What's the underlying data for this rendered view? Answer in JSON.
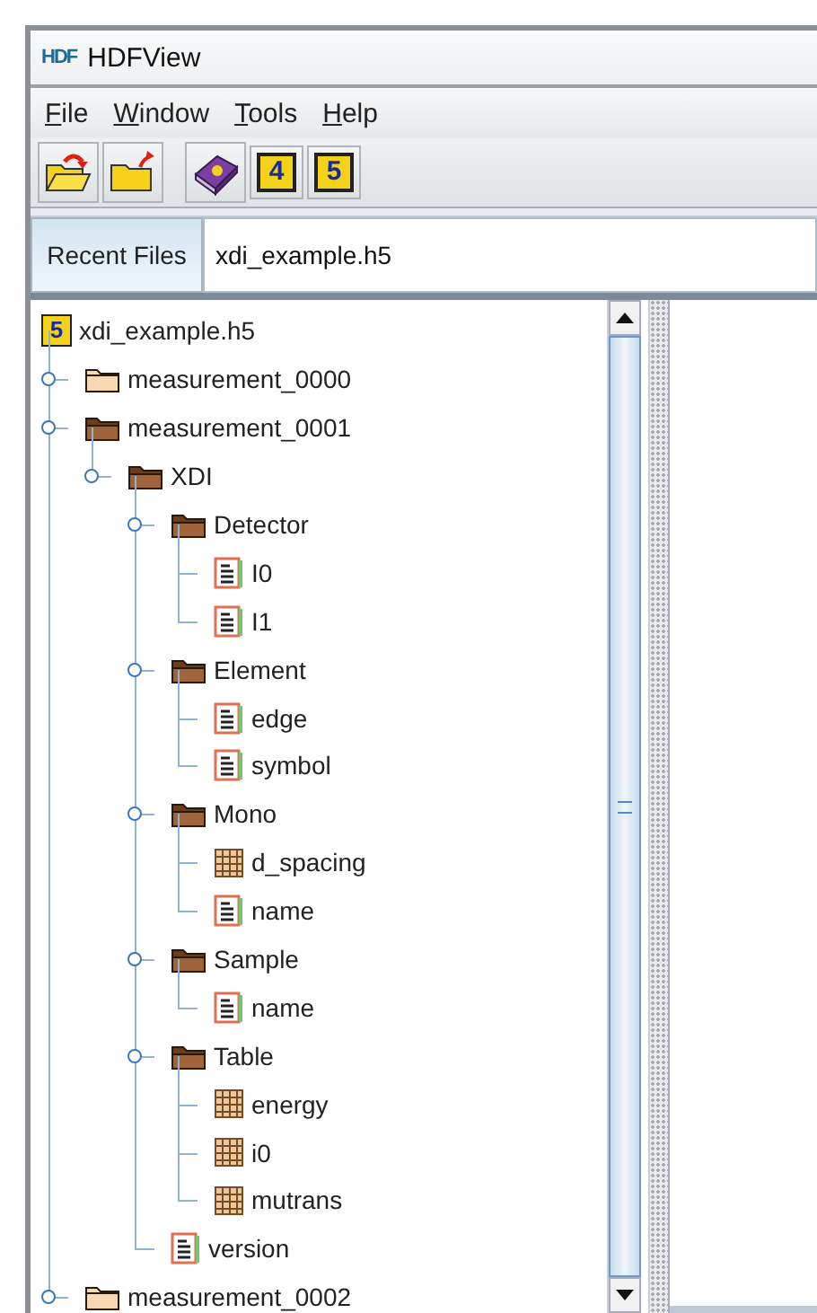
{
  "window": {
    "logo": "HDF",
    "title": "HDFView"
  },
  "menu": [
    {
      "key": "F",
      "rest": "ile"
    },
    {
      "key": "W",
      "rest": "indow"
    },
    {
      "key": "T",
      "rest": "ools"
    },
    {
      "key": "H",
      "rest": "elp"
    }
  ],
  "toolbar": [
    {
      "kind": "open"
    },
    {
      "kind": "close"
    },
    {
      "kind": "help"
    },
    {
      "kind": "hdf4",
      "label": "4"
    },
    {
      "kind": "hdf5",
      "label": "5"
    }
  ],
  "recent": {
    "button": "Recent Files",
    "value": "xdi_example.h5"
  },
  "tree": {
    "kind": "file",
    "badge": "5",
    "label": "xdi_example.h5",
    "children": [
      {
        "kind": "group",
        "label": "measurement_0000",
        "expanded": false
      },
      {
        "kind": "group",
        "label": "measurement_0001",
        "expanded": true,
        "children": [
          {
            "kind": "group",
            "label": "XDI",
            "expanded": true,
            "children": [
              {
                "kind": "group",
                "label": "Detector",
                "expanded": true,
                "children": [
                  {
                    "kind": "text",
                    "label": "I0"
                  },
                  {
                    "kind": "text",
                    "label": "I1"
                  }
                ]
              },
              {
                "kind": "group",
                "label": "Element",
                "expanded": true,
                "children": [
                  {
                    "kind": "text",
                    "label": "edge"
                  },
                  {
                    "kind": "text",
                    "label": "symbol"
                  }
                ]
              },
              {
                "kind": "group",
                "label": "Mono",
                "expanded": true,
                "children": [
                  {
                    "kind": "table",
                    "label": "d_spacing"
                  },
                  {
                    "kind": "text",
                    "label": "name"
                  }
                ]
              },
              {
                "kind": "group",
                "label": "Sample",
                "expanded": true,
                "children": [
                  {
                    "kind": "text",
                    "label": "name"
                  }
                ]
              },
              {
                "kind": "group",
                "label": "Table",
                "expanded": true,
                "children": [
                  {
                    "kind": "table",
                    "label": "energy"
                  },
                  {
                    "kind": "table",
                    "label": "i0"
                  },
                  {
                    "kind": "table",
                    "label": "mutrans"
                  }
                ]
              },
              {
                "kind": "text",
                "label": "version"
              }
            ]
          }
        ]
      },
      {
        "kind": "group",
        "label": "measurement_0002",
        "expanded": false
      }
    ]
  }
}
